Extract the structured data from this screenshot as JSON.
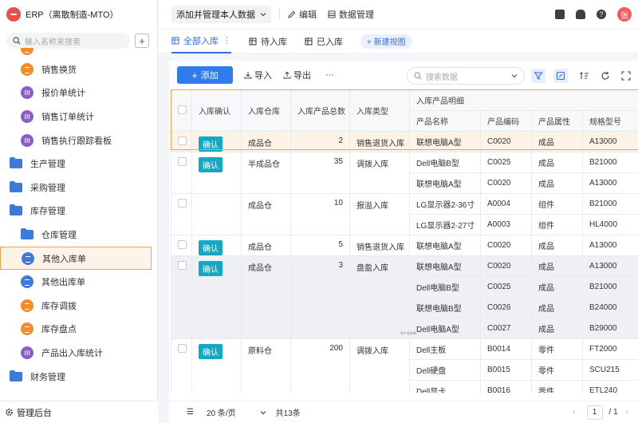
{
  "app": {
    "title": "ERP（离散制造-MTO）"
  },
  "sidebar": {
    "search_placeholder": "输入名称来搜索",
    "items": [
      {
        "label": "",
        "type": "child",
        "icon": "orange"
      },
      {
        "label": "销售换货",
        "type": "child",
        "icon": "orange"
      },
      {
        "label": "报价单统计",
        "type": "child",
        "icon": "purple"
      },
      {
        "label": "销售订单统计",
        "type": "child",
        "icon": "purple"
      },
      {
        "label": "销售执行跟踪看板",
        "type": "child",
        "icon": "purple"
      },
      {
        "label": "生产管理",
        "type": "parent",
        "icon": "folder"
      },
      {
        "label": "采购管理",
        "type": "parent",
        "icon": "folder"
      },
      {
        "label": "库存管理",
        "type": "parent",
        "icon": "folder"
      },
      {
        "label": "仓库管理",
        "type": "child",
        "icon": "folder"
      },
      {
        "label": "其他入库单",
        "type": "child",
        "icon": "blue",
        "active": true
      },
      {
        "label": "其他出库单",
        "type": "child",
        "icon": "blue"
      },
      {
        "label": "库存调拨",
        "type": "child",
        "icon": "orange"
      },
      {
        "label": "库存盘点",
        "type": "child",
        "icon": "orange"
      },
      {
        "label": "产品出入库统计",
        "type": "child",
        "icon": "purple"
      },
      {
        "label": "财务管理",
        "type": "parent",
        "icon": "folder"
      }
    ],
    "footer_label": "管理后台"
  },
  "topbar": {
    "view_name": "添加并管理本人数据",
    "edit_label": "编辑",
    "data_manage_label": "数据管理",
    "avatar_text": "张"
  },
  "tabs": [
    {
      "label": "全部入库",
      "active": true
    },
    {
      "label": "待入库"
    },
    {
      "label": "已入库"
    }
  ],
  "new_view_label": "+ 新建视图",
  "toolbar": {
    "add_label": "添加",
    "import_label": "导入",
    "export_label": "导出",
    "more_label": "···",
    "search_placeholder": "搜索数据"
  },
  "table": {
    "headers": {
      "confirm": "入库确认",
      "warehouse": "入库仓库",
      "total": "入库产品总数",
      "type": "入库类型",
      "detail": "入库产品明细",
      "product_name": "产品名称",
      "product_code": "产品编码",
      "product_attr": "产品属性",
      "spec": "规格型号"
    },
    "records": [
      {
        "confirm": "确认",
        "warehouse": "成品仓",
        "total": "2",
        "type": "销售退货入库",
        "highlight": true,
        "lines": [
          [
            "联想电脑A型",
            "C0020",
            "成品",
            "A13000"
          ]
        ]
      },
      {
        "confirm": "确认",
        "warehouse": "半成品仓",
        "total": "35",
        "type": "调拨入库",
        "lines": [
          [
            "Dell电脑B型",
            "C0025",
            "成品",
            "B21000"
          ],
          [
            "联想电脑A型",
            "C0020",
            "成品",
            "A13000"
          ]
        ]
      },
      {
        "confirm": "",
        "warehouse": "成品仓",
        "total": "10",
        "type": "报溢入库",
        "lines": [
          [
            "LG显示器2-36寸",
            "A0004",
            "组件",
            "B21000"
          ],
          [
            "LG显示器2-27寸",
            "A0003",
            "组件",
            "HL4000"
          ]
        ]
      },
      {
        "confirm": "确认",
        "warehouse": "成品仓",
        "total": "5",
        "type": "销售退货入库",
        "lines": [
          [
            "联想电脑A型",
            "C0020",
            "成品",
            "A13000"
          ]
        ]
      },
      {
        "confirm": "确认",
        "warehouse": "成品仓",
        "total": "3",
        "type": "盘盈入库",
        "gray": true,
        "lines": [
          [
            "联想电脑A型",
            "C0020",
            "成品",
            "A13000"
          ],
          [
            "Dell电脑B型",
            "C0025",
            "成品",
            "B21000"
          ],
          [
            "联想电脑B型",
            "C0026",
            "成品",
            "B24000"
          ],
          [
            "Dell电脑A型",
            "C0027",
            "成品",
            "B29000"
          ]
        ]
      },
      {
        "confirm": "确认",
        "warehouse": "原料仓",
        "total": "200",
        "type": "调拨入库",
        "lines": [
          [
            "Dell主板",
            "B0014",
            "零件",
            "FT2000"
          ],
          [
            "Dell硬盘",
            "B0015",
            "零件",
            "SCU215"
          ],
          [
            "Dell显卡",
            "B0016",
            "零件",
            "ETL240"
          ]
        ]
      }
    ],
    "tiny_note": "生产任务单"
  },
  "pager": {
    "page_size": "20 条/页",
    "total": "共13条",
    "current": "1",
    "pages": "/ 1"
  }
}
